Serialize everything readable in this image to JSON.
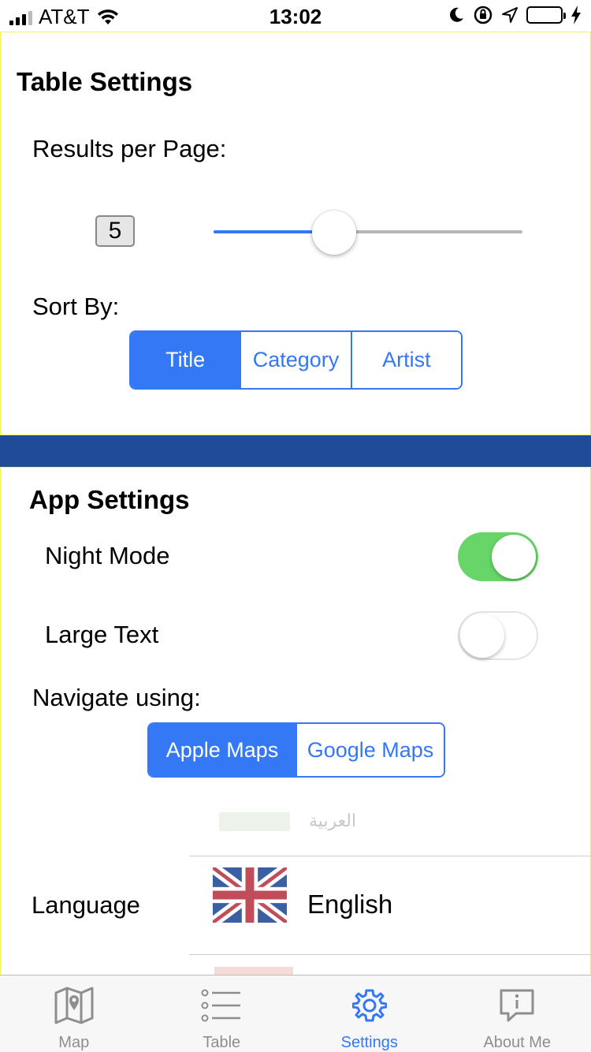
{
  "status_bar": {
    "carrier": "AT&T",
    "time": "13:02"
  },
  "table_settings": {
    "title": "Table Settings",
    "results_label": "Results per Page:",
    "results_value": "5",
    "slider_fraction": 0.39,
    "sort_label": "Sort By:",
    "sort_options": [
      "Title",
      "Category",
      "Artist"
    ],
    "sort_selected": "Title"
  },
  "app_settings": {
    "title": "App Settings",
    "night_mode_label": "Night Mode",
    "night_mode_on": true,
    "large_text_label": "Large Text",
    "large_text_on": false,
    "navigate_label": "Navigate using:",
    "navigate_options": [
      "Apple Maps",
      "Google Maps"
    ],
    "navigate_selected": "Apple Maps",
    "language_label": "Language",
    "language_prev": "العربية",
    "language_selected": "English"
  },
  "tab_bar": {
    "tabs": [
      {
        "label": "Map",
        "icon": "map-icon"
      },
      {
        "label": "Table",
        "icon": "list-icon"
      },
      {
        "label": "Settings",
        "icon": "gear-icon"
      },
      {
        "label": "About Me",
        "icon": "info-bubble-icon"
      }
    ],
    "active": "Settings"
  },
  "colors": {
    "accent": "#3478f6",
    "switch_on": "#67d567",
    "band": "#1f4b99",
    "panel_border": "#f3f350"
  }
}
